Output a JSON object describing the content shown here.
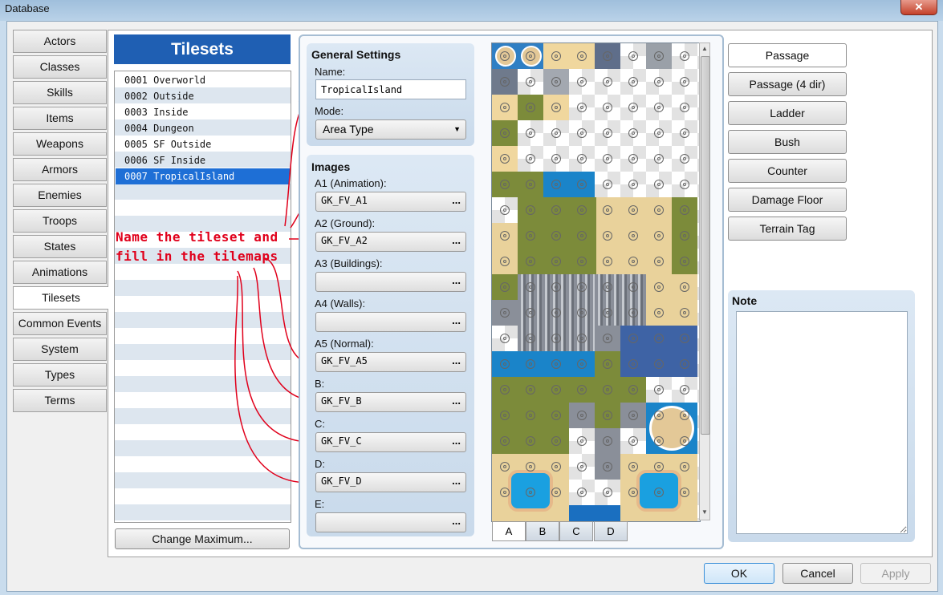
{
  "window": {
    "title": "Database",
    "close_symbol": "✕"
  },
  "categories": [
    "Actors",
    "Classes",
    "Skills",
    "Items",
    "Weapons",
    "Armors",
    "Enemies",
    "Troops",
    "States",
    "Animations",
    "Tilesets",
    "Common Events",
    "System",
    "Types",
    "Terms"
  ],
  "active_category": "Tilesets",
  "tilesets": {
    "header": "Tilesets",
    "items": [
      "0001 Overworld",
      "0002 Outside",
      "0003 Inside",
      "0004 Dungeon",
      "0005 SF Outside",
      "0006 SF Inside",
      "0007 TropicalIsland"
    ],
    "selected_index": 6,
    "change_max_label": "Change Maximum..."
  },
  "general": {
    "title": "General Settings",
    "name_label": "Name:",
    "name_value": "TropicalIsland",
    "mode_label": "Mode:",
    "mode_value": "Area Type"
  },
  "images": {
    "title": "Images",
    "slots": [
      {
        "label": "A1 (Animation):",
        "value": "GK_FV_A1"
      },
      {
        "label": "A2 (Ground):",
        "value": "GK_FV_A2"
      },
      {
        "label": "A3 (Buildings):",
        "value": ""
      },
      {
        "label": "A4 (Walls):",
        "value": ""
      },
      {
        "label": "A5 (Normal):",
        "value": "GK_FV_A5"
      },
      {
        "label": "B:",
        "value": "GK_FV_B"
      },
      {
        "label": "C:",
        "value": "GK_FV_C"
      },
      {
        "label": "D:",
        "value": "GK_FV_D"
      },
      {
        "label": "E:",
        "value": ""
      }
    ],
    "browse_symbol": "..."
  },
  "tile_tabs": [
    "A",
    "B",
    "C",
    "D"
  ],
  "active_tile_tab": "A",
  "passage_buttons": [
    "Passage",
    "Passage (4 dir)",
    "Ladder",
    "Bush",
    "Counter",
    "Damage Floor",
    "Terrain Tag"
  ],
  "note": {
    "title": "Note",
    "value": ""
  },
  "annotation": {
    "line1": "Name the tileset and",
    "line2": "fill in the tilemaps",
    "color": "#e0001b"
  },
  "footer": {
    "ok": "OK",
    "cancel": "Cancel",
    "apply": "Apply"
  },
  "colors": {
    "selection": "#1e6fd6",
    "header": "#1f5fb3",
    "grass": "#7c8b3a",
    "sand": "#e9d29b",
    "water": "#1a84c9",
    "deep_water": "#3e63a5",
    "rock": "#8a8f99"
  }
}
